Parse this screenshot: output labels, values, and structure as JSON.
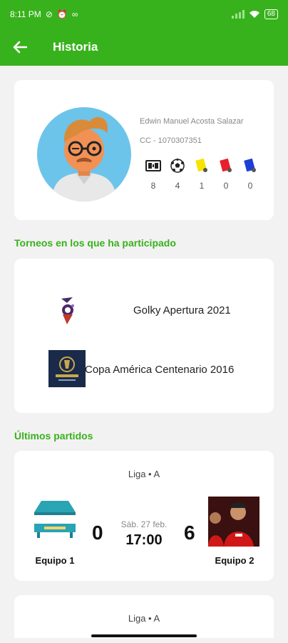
{
  "status_bar": {
    "time": "8:11 PM",
    "battery": "68"
  },
  "app_bar": {
    "title": "Historia",
    "back_icon": "arrow-left-icon"
  },
  "profile": {
    "name": "Edwin Manuel  Acosta Salazar",
    "id_label": "CC - 1070307351",
    "stats": [
      {
        "icon": "scoreboard-icon",
        "value": "8"
      },
      {
        "icon": "soccer-ball-icon",
        "value": "4"
      },
      {
        "icon": "yellow-card-icon",
        "value": "1",
        "color": "#f5e400"
      },
      {
        "icon": "red-card-icon",
        "value": "0",
        "color": "#e8202b"
      },
      {
        "icon": "blue-card-icon",
        "value": "0",
        "color": "#1e3fd6"
      }
    ]
  },
  "torneos": {
    "title": "Torneos en los que ha participado",
    "items": [
      {
        "name": "Golky Apertura 2021"
      },
      {
        "name": "Copa América Centenario 2016"
      }
    ]
  },
  "partidos": {
    "title": "Últimos partidos",
    "matches": [
      {
        "league": "Liga • A",
        "home_team": "Equipo 1",
        "away_team": "Equipo 2",
        "home_score": "0",
        "away_score": "6",
        "date": "Sáb. 27 feb.",
        "time": "17:00"
      },
      {
        "league": "Liga • A"
      }
    ]
  },
  "colors": {
    "primary": "#38b21c",
    "background": "#f2f2f2"
  }
}
